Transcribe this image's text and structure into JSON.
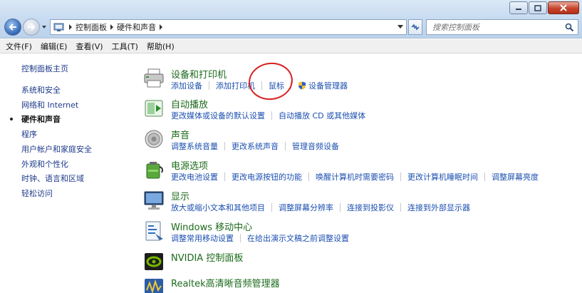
{
  "window": {
    "caption_buttons": [
      "minimize-icon",
      "maximize-icon",
      "close-icon"
    ]
  },
  "address": {
    "crumbs": [
      "控制面板",
      "硬件和声音"
    ],
    "search_placeholder": "搜索控制面板"
  },
  "menu": {
    "items": [
      "文件(F)",
      "编辑(E)",
      "查看(V)",
      "工具(T)",
      "帮助(H)"
    ]
  },
  "sidebar": {
    "items": [
      {
        "label": "控制面板主页",
        "current": false
      },
      {
        "label": "系统和安全",
        "current": false
      },
      {
        "label": "网络和 Internet",
        "current": false
      },
      {
        "label": "硬件和声音",
        "current": true
      },
      {
        "label": "程序",
        "current": false
      },
      {
        "label": "用户帐户和家庭安全",
        "current": false
      },
      {
        "label": "外观和个性化",
        "current": false
      },
      {
        "label": "时钟、语言和区域",
        "current": false
      },
      {
        "label": "轻松访问",
        "current": false
      }
    ]
  },
  "categories": [
    {
      "title": "设备和打印机",
      "icon": "printer-icon",
      "links": [
        "添加设备",
        "添加打印机",
        "鼠标",
        "设备管理器"
      ]
    },
    {
      "title": "自动播放",
      "icon": "autoplay-icon",
      "links": [
        "更改媒体或设备的默认设置",
        "自动播放 CD 或其他媒体"
      ]
    },
    {
      "title": "声音",
      "icon": "speaker-icon",
      "links": [
        "调整系统音量",
        "更改系统声音",
        "管理音频设备"
      ]
    },
    {
      "title": "电源选项",
      "icon": "battery-icon",
      "links": [
        "更改电池设置",
        "更改电源按钮的功能",
        "唤醒计算机时需要密码",
        "更改计算机睡眠时间",
        "调整屏幕亮度"
      ]
    },
    {
      "title": "显示",
      "icon": "monitor-icon",
      "links": [
        "放大或缩小文本和其他项目",
        "调整屏幕分辨率",
        "连接到投影仪",
        "连接到外部显示器"
      ]
    },
    {
      "title": "Windows 移动中心",
      "icon": "mobility-center-icon",
      "links": [
        "调整常用移动设置",
        "在给出演示文稿之前调整设置"
      ]
    },
    {
      "title": "NVIDIA 控制面板",
      "icon": "nvidia-icon",
      "links": []
    },
    {
      "title": "Realtek高清晰音频管理器",
      "icon": "realtek-icon",
      "links": []
    }
  ],
  "colors": {
    "category_title": "#1b6a1b",
    "task_link": "#1c4fb0",
    "annotation_circle": "#d92020"
  }
}
